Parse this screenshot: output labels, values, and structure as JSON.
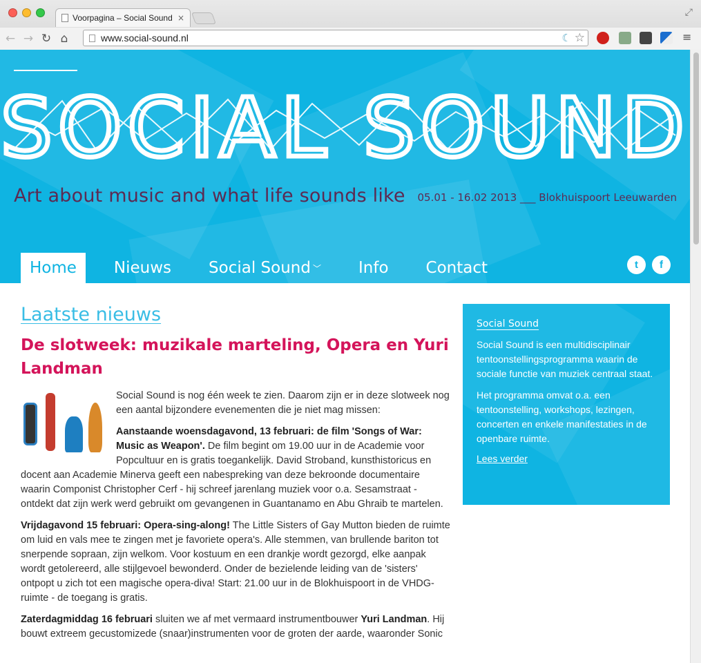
{
  "browser": {
    "tab_title": "Voorpagina – Social Sound",
    "tab_close": "×",
    "url": "www.social-sound.nl"
  },
  "header": {
    "logo_text": "SOCIAL SOUND",
    "tagline": "Art about music and what life sounds like",
    "dates": "05.01 - 16.02 2013 ___ Blokhuispoort Leeuwarden"
  },
  "nav": {
    "items": [
      {
        "label": "Home"
      },
      {
        "label": "Nieuws"
      },
      {
        "label": "Social Sound"
      },
      {
        "label": "Info"
      },
      {
        "label": "Contact"
      }
    ],
    "active": "Home",
    "social": {
      "twitter": "t",
      "facebook": "f"
    }
  },
  "main": {
    "section_title": "Laatste nieuws",
    "post_title": "De slotweek: muzikale marteling, Opera en Yuri Landman",
    "p1": "Social Sound is nog één week te zien. Daarom zijn er in deze slotweek nog een aantal bijzondere evenementen die je niet mag missen:",
    "p2_bold": "Aanstaande woensdagavond, 13 februari: de film 'Songs of War: Music as Weapon'.",
    "p2_text": " De film begint om 19.00 uur in de Academie voor Popcultuur en is gratis toegankelijk. David Stroband, kunsthistoricus en docent aan Academie Minerva geeft een nabespreking van deze bekroonde documentaire waarin Componist Christopher Cerf - hij schreef jarenlang muziek voor o.a. Sesamstraat - ontdekt dat zijn werk werd gebruikt om gevangenen in Guantanamo en Abu Ghraib te martelen.",
    "p3_bold": "Vrijdagavond 15 februari: Opera-sing-along!",
    "p3_text": " The Little Sisters of Gay Mutton bieden de ruimte om luid en vals mee te zingen met je favoriete opera's. Alle stemmen, van brullende bariton tot snerpende sopraan, zijn welkom. Voor kostuum en een drankje wordt gezorgd, elke aanpak wordt getolereerd, alle stijlgevoel bewonderd. Onder de bezielende leiding van de 'sisters' ontpopt u zich tot een magische opera-diva! Start: 21.00 uur in de Blokhuispoort in de VHDG-ruimte - de toegang is gratis.",
    "p4_bold": "Zaterdagmiddag 16 februari",
    "p4_text": " sluiten we af met vermaard instrumentbouwer ",
    "p4_bold2": "Yuri Landman",
    "p4_text2": ". Hij bouwt extreem gecustomizede (snaar)instrumenten voor de groten der aarde, waaronder Sonic"
  },
  "sidebar": {
    "title": "Social Sound",
    "p1": "Social Sound is een multidisciplinair tentoonstellingsprogramma waarin de sociale functie van muziek centraal staat.",
    "p2": "Het programma omvat o.a. een tentoonstelling, workshops, lezingen, concerten en enkele manifestaties in de openbare ruimte.",
    "link": "Lees verder"
  },
  "colors": {
    "brand_blue": "#0fb4e2",
    "plum": "#5c2a52",
    "headline_pink": "#d4145a",
    "link_blue": "#39bde5"
  }
}
